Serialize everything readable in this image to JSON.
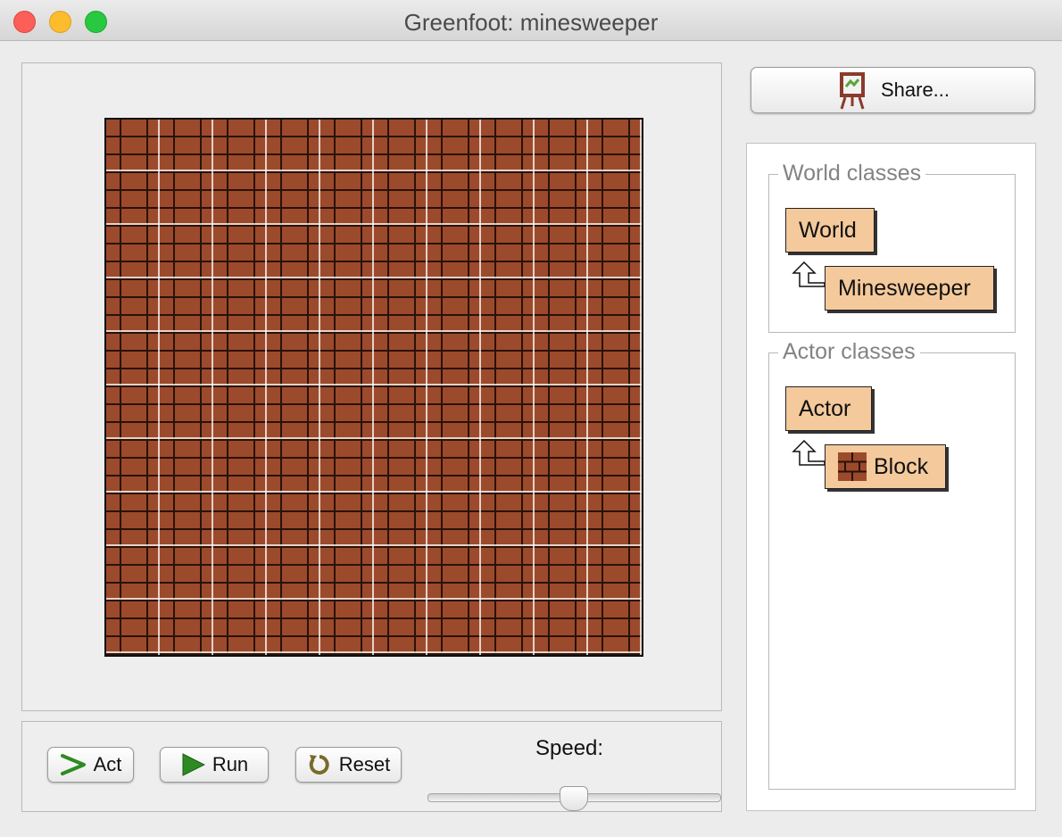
{
  "window": {
    "title": "Greenfoot: minesweeper"
  },
  "controls": {
    "act_label": "Act",
    "run_label": "Run",
    "reset_label": "Reset",
    "speed_label": "Speed:",
    "speed_value_fraction": 0.5
  },
  "sidebar": {
    "share_label": "Share...",
    "world_group": {
      "label": "World classes",
      "classes": [
        "World",
        "Minesweeper"
      ]
    },
    "actor_group": {
      "label": "Actor classes",
      "classes": [
        "Actor",
        "Block"
      ]
    }
  },
  "colors": {
    "brick": "#9c4a2c",
    "mortar": "#2a1208",
    "class_box": "#f4c99b",
    "run_green": "#2e8b23"
  },
  "icons": {
    "act": "act-arrow-icon",
    "run": "run-play-icon",
    "reset": "reset-icon",
    "share": "share-easel-icon",
    "block": "block-brick-icon"
  }
}
